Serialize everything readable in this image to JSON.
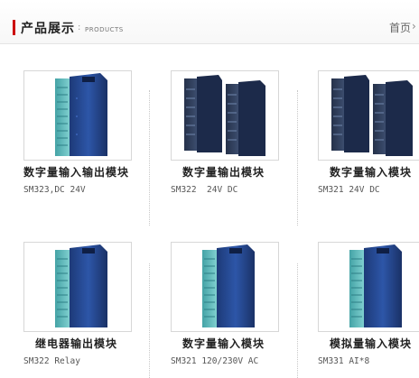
{
  "header": {
    "title": "产品展示",
    "separator": ":",
    "subtitle": "PRODUCTS",
    "home_link": "首页",
    "arrow_icon": "chevron-right-icon",
    "accent_color": "#cc0000"
  },
  "products": [
    {
      "name": "数字量输入输出模块",
      "model": "SM323,DC 24V",
      "image": "single-module"
    },
    {
      "name": "数字量输出模块",
      "model": "SM322  24V DC",
      "image": "double-module"
    },
    {
      "name": "数字量输入模块",
      "model": "SM321 24V DC",
      "image": "double-module"
    },
    {
      "name": "继电器输出模块",
      "model": "SM322 Relay",
      "image": "single-module"
    },
    {
      "name": "数字量输入模块",
      "model": "SM321 120/230V AC",
      "image": "single-module"
    },
    {
      "name": "模拟量输入模块",
      "model": "SM331 AI*8",
      "image": "single-module"
    }
  ]
}
